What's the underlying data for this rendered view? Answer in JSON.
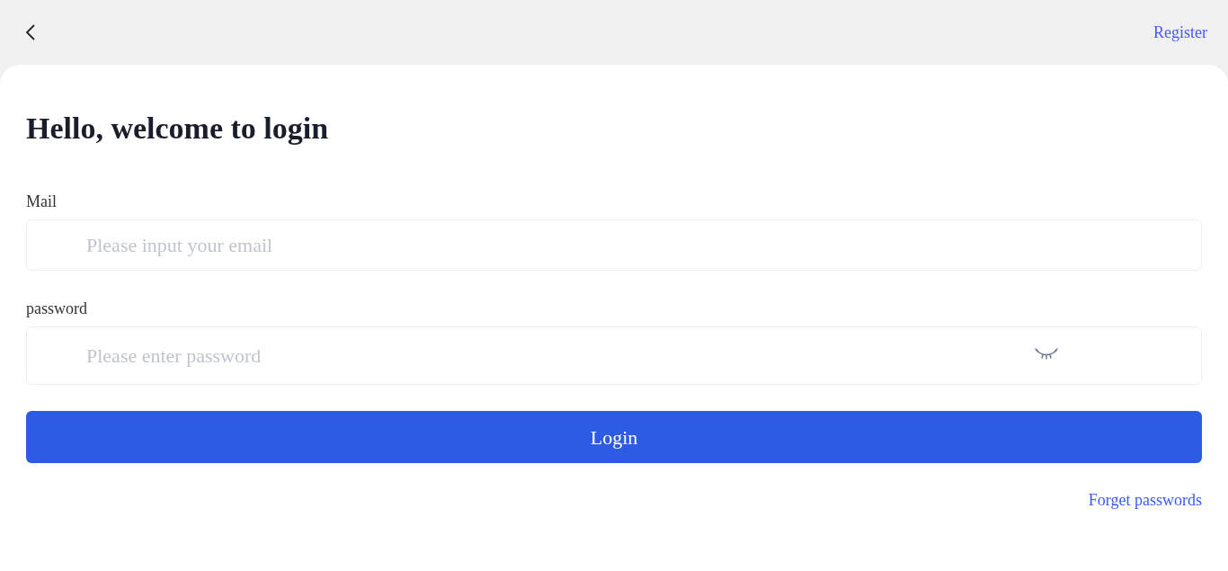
{
  "header": {
    "register_link": "Register"
  },
  "title": "Hello, welcome to login",
  "fields": [
    {
      "label": "Mail",
      "placeholder": "Please input your email",
      "kind": "text"
    },
    {
      "label": "password",
      "placeholder": "Please enter password",
      "kind": "password",
      "password_visible": false
    }
  ],
  "login_button": "Login",
  "forgot_link": "Forget passwords"
}
